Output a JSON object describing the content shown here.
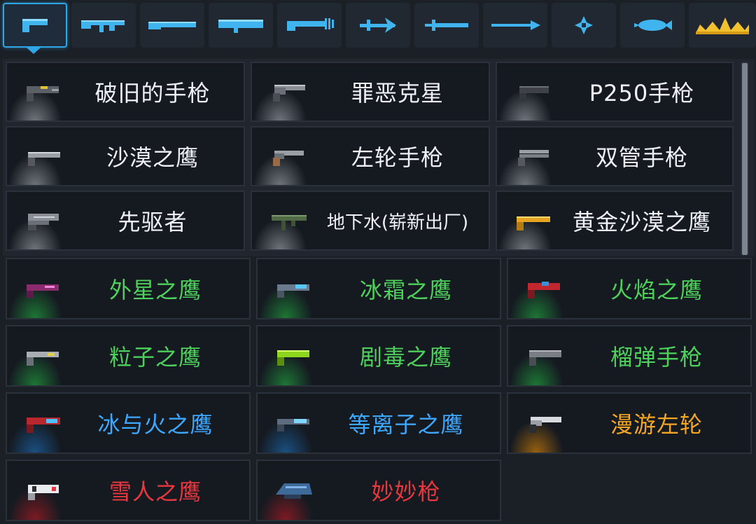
{
  "colors": {
    "accent": "#2fa6e6",
    "white": "#eef2f6",
    "green": "#4ed15c",
    "blue": "#3ea8ff",
    "orange": "#f5a623",
    "red": "#e8373f"
  },
  "tabs": [
    {
      "icon": "pistol-icon",
      "selected": true
    },
    {
      "icon": "rifle-icon"
    },
    {
      "icon": "shotgun-icon"
    },
    {
      "icon": "launcher-icon"
    },
    {
      "icon": "laser-rifle-icon"
    },
    {
      "icon": "bow-icon"
    },
    {
      "icon": "sword-icon"
    },
    {
      "icon": "spear-icon"
    },
    {
      "icon": "shuriken-icon"
    },
    {
      "icon": "fish-icon"
    },
    {
      "icon": "crown-icon"
    }
  ],
  "weapons": [
    {
      "name": "破旧的手枪",
      "color": "white"
    },
    {
      "name": "罪恶克星",
      "color": "white"
    },
    {
      "name": "P250手枪",
      "color": "white"
    },
    {
      "name": "沙漠之鹰",
      "color": "white"
    },
    {
      "name": "左轮手枪",
      "color": "white"
    },
    {
      "name": "双管手枪",
      "color": "white"
    },
    {
      "name": "先驱者",
      "color": "white"
    },
    {
      "name": "地下水(崭新出厂)",
      "color": "white"
    },
    {
      "name": "黄金沙漠之鹰",
      "color": "white"
    },
    {
      "name": "外星之鹰",
      "color": "green"
    },
    {
      "name": "冰霜之鹰",
      "color": "green"
    },
    {
      "name": "火焰之鹰",
      "color": "green"
    },
    {
      "name": "粒子之鹰",
      "color": "green"
    },
    {
      "name": "剧毒之鹰",
      "color": "green"
    },
    {
      "name": "榴弹手枪",
      "color": "green"
    },
    {
      "name": "冰与火之鹰",
      "color": "blue"
    },
    {
      "name": "等离子之鹰",
      "color": "blue"
    },
    {
      "name": "漫游左轮",
      "color": "orange"
    },
    {
      "name": "雪人之鹰",
      "color": "red"
    },
    {
      "name": "妙妙枪",
      "color": "red"
    }
  ]
}
